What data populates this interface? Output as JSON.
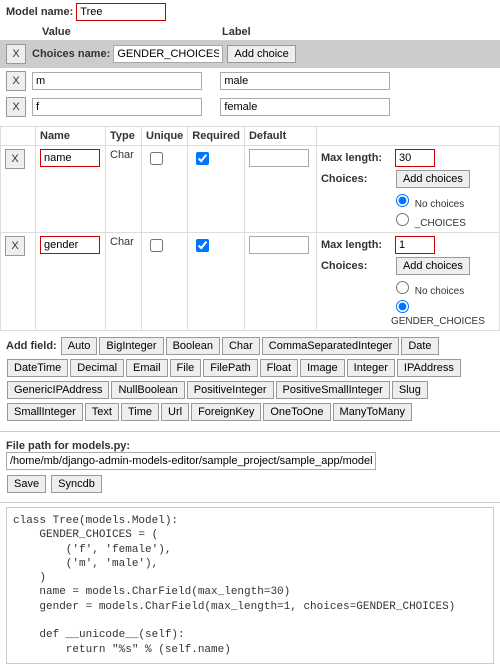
{
  "model_name_label": "Model name:",
  "model_name_value": "Tree",
  "value_header": "Value",
  "label_header": "Label",
  "choices_name_label": "Choices name:",
  "choices_name_value": "GENDER_CHOICES",
  "add_choice_btn": "Add choice",
  "x_btn": "X",
  "choices": [
    {
      "value": "m",
      "label": "male"
    },
    {
      "value": "f",
      "label": "female"
    }
  ],
  "field_headers": {
    "name": "Name",
    "type": "Type",
    "unique": "Unique",
    "required": "Required",
    "default": "Default"
  },
  "fields": [
    {
      "name": "name",
      "type": "Char",
      "unique": false,
      "required": true,
      "default": "",
      "max_length": "30",
      "max_length_label": "Max length:",
      "choices_label": "Choices:",
      "add_choices_btn": "Add choices",
      "choice_opts": [
        "No choices",
        "_CHOICES"
      ],
      "choice_selected": 0
    },
    {
      "name": "gender",
      "type": "Char",
      "unique": false,
      "required": true,
      "default": "",
      "max_length": "1",
      "max_length_label": "Max length:",
      "choices_label": "Choices:",
      "add_choices_btn": "Add choices",
      "choice_opts": [
        "No choices",
        "GENDER_CHOICES"
      ],
      "choice_selected": 1
    }
  ],
  "add_field_label": "Add field:",
  "field_types": [
    "Auto",
    "BigInteger",
    "Boolean",
    "Char",
    "CommaSeparatedInteger",
    "Date",
    "DateTime",
    "Decimal",
    "Email",
    "File",
    "FilePath",
    "Float",
    "Image",
    "Integer",
    "IPAddress",
    "GenericIPAddress",
    "NullBoolean",
    "PositiveInteger",
    "PositiveSmallInteger",
    "Slug",
    "SmallInteger",
    "Text",
    "Time",
    "Url",
    "ForeignKey",
    "OneToOne",
    "ManyToMany"
  ],
  "filepath_label": "File path for models.py:",
  "filepath_value": "/home/mb/django-admin-models-editor/sample_project/sample_app/models.py",
  "save_btn": "Save",
  "syncdb_btn": "Syncdb",
  "code": "class Tree(models.Model):\n    GENDER_CHOICES = (\n        ('f', 'female'),\n        ('m', 'male'),\n    )\n    name = models.CharField(max_length=30)\n    gender = models.CharField(max_length=1, choices=GENDER_CHOICES)\n\n    def __unicode__(self):\n        return \"%s\" % (self.name)"
}
